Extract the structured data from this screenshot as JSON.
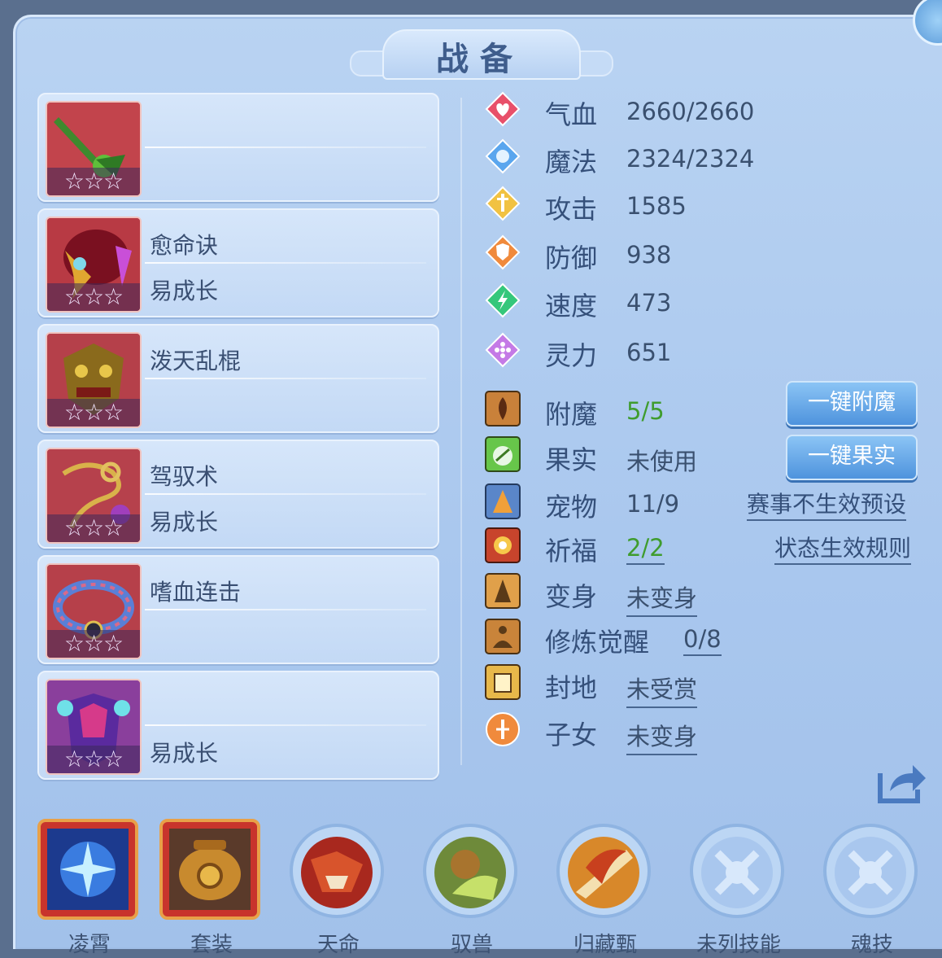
{
  "title": "战备",
  "skills": [
    {
      "line1": "",
      "line2": "",
      "stars": "☆☆☆",
      "icon": "green-dragon-weapon-icon"
    },
    {
      "line1": "愈命诀",
      "line2": "易成长",
      "stars": "☆☆☆",
      "icon": "red-shield-icon"
    },
    {
      "line1": "泼天乱棍",
      "line2": "",
      "stars": "☆☆☆",
      "icon": "demon-mask-icon"
    },
    {
      "line1": "驾驭术",
      "line2": "易成长",
      "stars": "☆☆☆",
      "icon": "golden-chain-icon"
    },
    {
      "line1": "嗜血连击",
      "line2": "",
      "stars": "☆☆☆",
      "icon": "beaded-bracelet-icon"
    },
    {
      "line1": "",
      "line2": "易成长",
      "stars": "☆☆☆",
      "icon": "purple-armor-icon"
    }
  ],
  "stats": [
    {
      "label": "气血",
      "value": "2660/2660",
      "icon": "heart-icon",
      "color": "#e8506a"
    },
    {
      "label": "魔法",
      "value": "2324/2324",
      "icon": "mana-icon",
      "color": "#5aa6ee"
    },
    {
      "label": "攻击",
      "value": "1585",
      "icon": "sword-icon",
      "color": "#f1c242"
    },
    {
      "label": "防御",
      "value": "938",
      "icon": "shield-icon",
      "color": "#f08a3c"
    },
    {
      "label": "速度",
      "value": "473",
      "icon": "lightning-icon",
      "color": "#35c77b"
    },
    {
      "label": "灵力",
      "value": "651",
      "icon": "spirit-icon",
      "color": "#c47ae6"
    }
  ],
  "features": {
    "enchant": {
      "label": "附魔",
      "value": "5/5",
      "button": "一键附魔"
    },
    "fruit": {
      "label": "果实",
      "value": "未使用",
      "button": "一键果实"
    },
    "pet": {
      "label": "宠物",
      "value": "11/9",
      "link": "赛事不生效预设"
    },
    "blessing": {
      "label": "祈福",
      "value": "2/2",
      "link": "状态生效规则"
    },
    "transform": {
      "label": "变身",
      "value": "未变身"
    },
    "cultivation": {
      "label": "修炼觉醒",
      "value": "0/8"
    },
    "fief": {
      "label": "封地",
      "value": "未受赏"
    },
    "children": {
      "label": "子女",
      "value": "未变身"
    }
  },
  "bottom_tabs": [
    {
      "label": "凌霄",
      "icon": "blue-star-orb-icon"
    },
    {
      "label": "套装",
      "icon": "golden-cauldron-icon"
    },
    {
      "label": "天命",
      "icon": "red-beast-icon"
    },
    {
      "label": "驭兽",
      "icon": "monkey-icon"
    },
    {
      "label": "归藏甄",
      "icon": "flaming-blade-icon"
    },
    {
      "label": "未列技能",
      "icon": "locked-skill-icon"
    },
    {
      "label": "魂技",
      "icon": "locked-skill-icon"
    }
  ]
}
